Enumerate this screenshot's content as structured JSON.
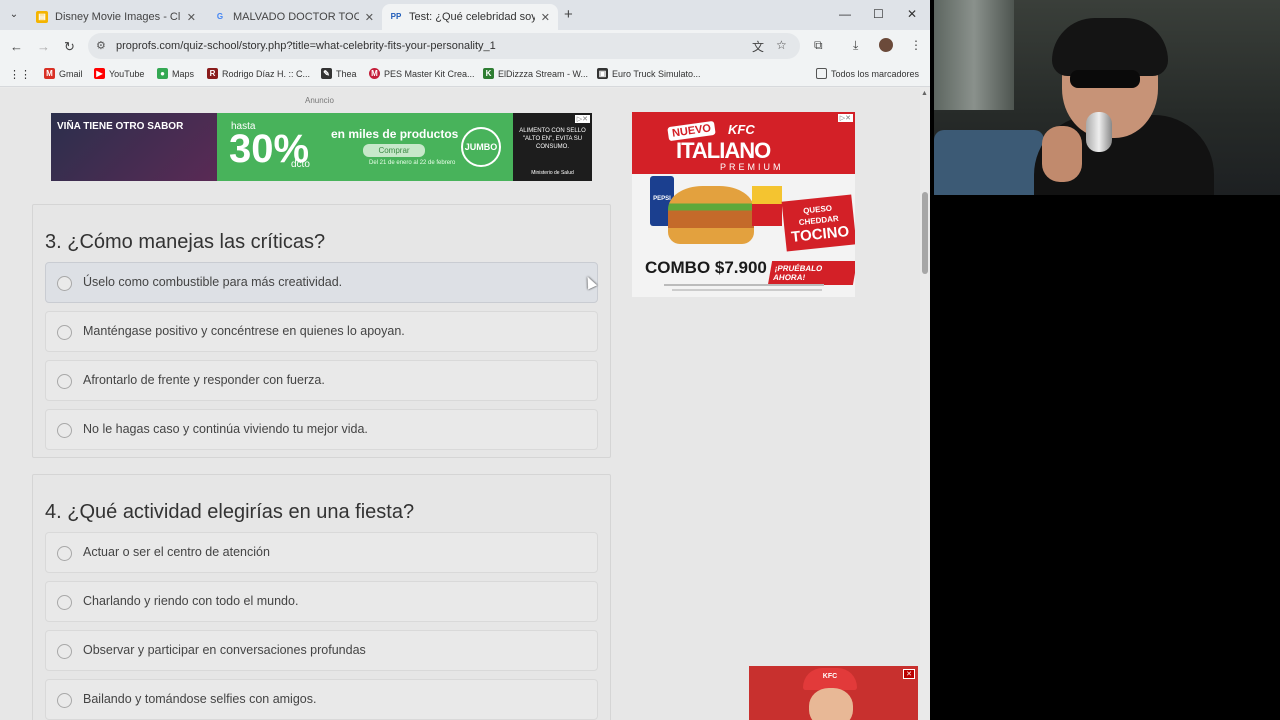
{
  "browser": {
    "tabs": [
      {
        "title": "Disney Movie Images - Click Ca",
        "active": false,
        "favicon": "yellow-doc-icon"
      },
      {
        "title": "MALVADO DOCTOR TOCINO - ",
        "active": false,
        "favicon": "google-icon"
      },
      {
        "title": "Test: ¿Qué celebridad soy? Des",
        "active": true,
        "favicon": "proprofs-icon"
      }
    ],
    "url": "proprofs.com/quiz-school/story.php?title=what-celebrity-fits-your-personality_1",
    "bookmarks": [
      {
        "label": "Gmail",
        "icon": "gmail-icon",
        "color": "#d93025"
      },
      {
        "label": "YouTube",
        "icon": "youtube-icon",
        "color": "#ff0000"
      },
      {
        "label": "Maps",
        "icon": "maps-icon",
        "color": "#34a853"
      },
      {
        "label": "Rodrigo Díaz H. :: C...",
        "icon": "site-icon",
        "color": "#8a1c1c"
      },
      {
        "label": "Thea",
        "icon": "quill-icon",
        "color": "#333333"
      },
      {
        "label": "PES Master Kit Crea...",
        "icon": "pes-icon",
        "color": "#c41e3a"
      },
      {
        "label": "ElDizzza Stream - W...",
        "icon": "green-site-icon",
        "color": "#2e7d32"
      },
      {
        "label": "Euro Truck Simulato...",
        "icon": "truck-icon",
        "color": "#333333"
      }
    ],
    "all_bookmarks": "Todos los marcadores"
  },
  "ads": {
    "label": "Anuncio",
    "jumbo": {
      "left_text": "VIÑA TIENE OTRO SABOR",
      "hasta": "hasta",
      "percent": "30%",
      "dcto": "dcto",
      "tagline": "en miles de productos",
      "button": "Comprar",
      "dates": "Del 21 de enero al 22 de febrero",
      "brand": "JUMBO",
      "warning": "ALIMENTO CON SELLO \"ALTO EN\", EVITA SU CONSUMO.",
      "ministerio": "Ministerio de Salud"
    },
    "kfc": {
      "nuevo": "NUEVO",
      "brand": "KFC",
      "title": "ITALIANO",
      "subtitle": "PREMIUM",
      "soda": "PEPSI",
      "queso": "QUESO",
      "cheddar": "CHEDDAR",
      "tocino": "TOCINO",
      "combo": "COMBO $7.900",
      "cta": "¡PRUÉBALO AHORA!"
    },
    "video": {
      "brand": "KFC"
    }
  },
  "quiz": {
    "questions": [
      {
        "title": "3. ¿Cómo manejas las críticas?",
        "options": [
          "Úselo como combustible para más creatividad.",
          "Manténgase positivo y concéntrese en quienes lo apoyan.",
          "Afrontarlo de frente y responder con fuerza.",
          "No le hagas caso y continúa viviendo tu mejor vida."
        ]
      },
      {
        "title": "4. ¿Qué actividad elegirías en una fiesta?",
        "options": [
          "Actuar o ser el centro de atención",
          "Charlando y riendo con todo el mundo.",
          "Observar y participar en conversaciones profundas",
          "Bailando y tomándose selfies con amigos."
        ]
      }
    ]
  }
}
